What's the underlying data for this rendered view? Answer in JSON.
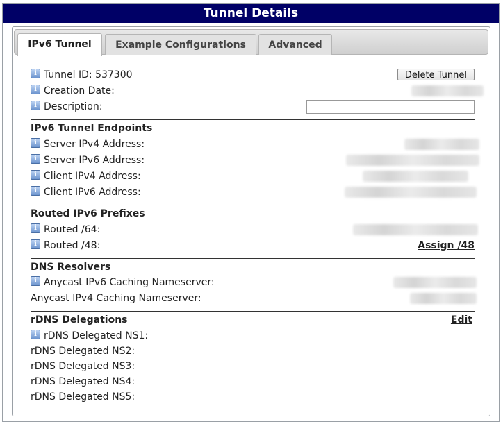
{
  "window_title": "Tunnel Details",
  "tabs": [
    {
      "label": "IPv6 Tunnel",
      "active": true
    },
    {
      "label": "Example Configurations",
      "active": false
    },
    {
      "label": "Advanced",
      "active": false
    }
  ],
  "tunnel": {
    "tunnel_id_label": "Tunnel ID: 537300",
    "delete_button": "Delete Tunnel",
    "creation_date_label": "Creation Date:",
    "description_label": "Description:",
    "description_value": ""
  },
  "endpoints": {
    "title": "IPv6 Tunnel Endpoints",
    "server_ipv4_label": "Server IPv4 Address:",
    "server_ipv6_label": "Server IPv6 Address:",
    "client_ipv4_label": "Client IPv4 Address:",
    "client_ipv6_label": "Client IPv6 Address:"
  },
  "prefixes": {
    "title": "Routed IPv6 Prefixes",
    "routed64_label": "Routed /64:",
    "routed48_label": "Routed /48:",
    "assign48_link": "Assign /48"
  },
  "dns": {
    "title": "DNS Resolvers",
    "anycast_ipv6_label": "Anycast IPv6 Caching Nameserver:",
    "anycast_ipv4_label": "Anycast IPv4 Caching Nameserver:"
  },
  "rdns": {
    "title": "rDNS Delegations",
    "edit_link": "Edit",
    "ns1_label": "rDNS Delegated NS1:",
    "ns2_label": "rDNS Delegated NS2:",
    "ns3_label": "rDNS Delegated NS3:",
    "ns4_label": "rDNS Delegated NS4:",
    "ns5_label": "rDNS Delegated NS5:"
  },
  "icons": {
    "info": "info-icon",
    "info_glyph": "i"
  },
  "colors": {
    "titlebar": "#000066",
    "tab_active": "#ffffff",
    "tab_inactive": "#e2e2e2"
  }
}
